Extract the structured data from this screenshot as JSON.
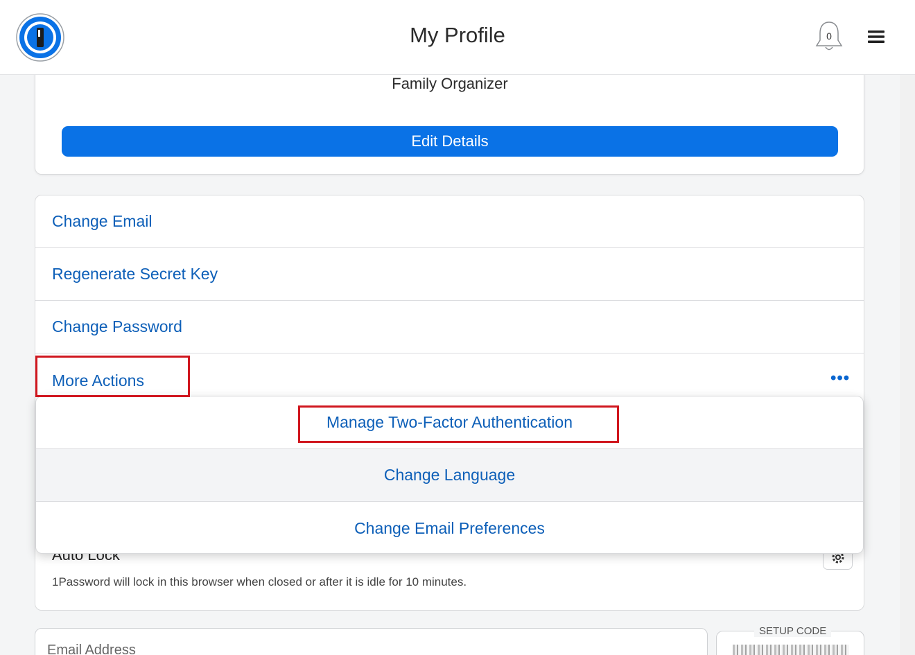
{
  "header": {
    "title": "My Profile",
    "notification_count": "0",
    "logo_icon": "1password-logo-icon",
    "bell_icon": "bell-icon",
    "menu_icon": "hamburger-menu-icon"
  },
  "profile": {
    "role": "Family Organizer",
    "edit_button_label": "Edit Details"
  },
  "actions": [
    {
      "label": "Change Email"
    },
    {
      "label": "Regenerate Secret Key"
    },
    {
      "label": "Change Password"
    },
    {
      "label": "More Actions"
    }
  ],
  "more_actions_menu": [
    {
      "label": "Manage Two-Factor Authentication"
    },
    {
      "label": "Change Language"
    },
    {
      "label": "Change Email Preferences"
    }
  ],
  "auto_lock": {
    "title": "Auto Lock",
    "description": "1Password will lock in this browser when closed or after it is idle for 10 minutes."
  },
  "fields": {
    "email_placeholder": "Email Address",
    "setup_code_label": "SETUP CODE"
  },
  "colors": {
    "accent": "#0a72e6",
    "link": "#0d5fb8",
    "highlight": "#d0161e"
  }
}
